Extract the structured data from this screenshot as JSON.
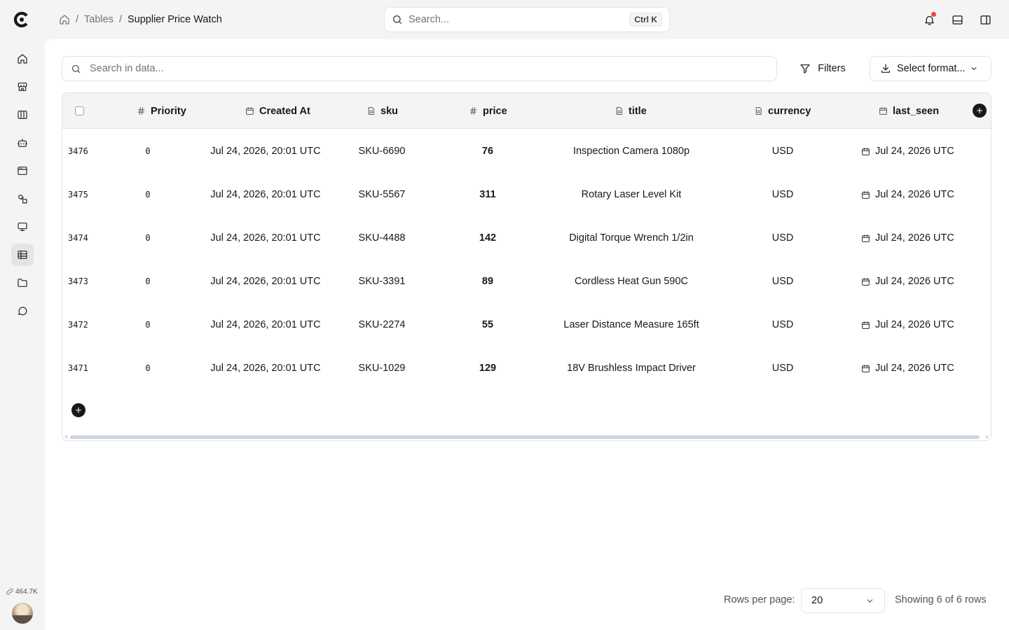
{
  "breadcrumb": {
    "separator": "/",
    "tables": "Tables",
    "current": "Supplier Price Watch"
  },
  "top_search": {
    "placeholder": "Search...",
    "shortcut": "Ctrl K"
  },
  "sidebar": {
    "items": [
      {
        "name": "home",
        "icon": "home-icon"
      },
      {
        "name": "store",
        "icon": "store-icon"
      },
      {
        "name": "columns",
        "icon": "columns-icon"
      },
      {
        "name": "bot",
        "icon": "bot-icon"
      },
      {
        "name": "browser",
        "icon": "browser-icon"
      },
      {
        "name": "shapes",
        "icon": "shapes-icon"
      },
      {
        "name": "monitor",
        "icon": "monitor-icon"
      },
      {
        "name": "tables",
        "icon": "table-icon",
        "active": true
      },
      {
        "name": "folder",
        "icon": "folder-icon"
      },
      {
        "name": "chat",
        "icon": "message-icon"
      }
    ],
    "usage": "464.7K"
  },
  "toolbar": {
    "search_placeholder": "Search in data...",
    "filters_label": "Filters",
    "format_label": "Select format..."
  },
  "table": {
    "columns": [
      {
        "key": "priority",
        "label": "Priority",
        "icon": "hash-icon"
      },
      {
        "key": "created_at",
        "label": "Created At",
        "icon": "calendar-icon"
      },
      {
        "key": "sku",
        "label": "sku",
        "icon": "text-icon"
      },
      {
        "key": "price",
        "label": "price",
        "icon": "hash-icon"
      },
      {
        "key": "title",
        "label": "title",
        "icon": "text-icon"
      },
      {
        "key": "currency",
        "label": "currency",
        "icon": "text-icon"
      },
      {
        "key": "last_seen",
        "label": "last_seen",
        "icon": "calendar-icon"
      }
    ],
    "rows": [
      {
        "id": "3476",
        "priority": "0",
        "created_at": "Jul 24, 2026, 20:01 UTC",
        "sku": "SKU-6690",
        "price": "76",
        "title": "Inspection Camera 1080p",
        "currency": "USD",
        "last_seen": "Jul 24, 2026 UTC"
      },
      {
        "id": "3475",
        "priority": "0",
        "created_at": "Jul 24, 2026, 20:01 UTC",
        "sku": "SKU-5567",
        "price": "311",
        "title": "Rotary Laser Level Kit",
        "currency": "USD",
        "last_seen": "Jul 24, 2026 UTC"
      },
      {
        "id": "3474",
        "priority": "0",
        "created_at": "Jul 24, 2026, 20:01 UTC",
        "sku": "SKU-4488",
        "price": "142",
        "title": "Digital Torque Wrench 1/2in",
        "currency": "USD",
        "last_seen": "Jul 24, 2026 UTC"
      },
      {
        "id": "3473",
        "priority": "0",
        "created_at": "Jul 24, 2026, 20:01 UTC",
        "sku": "SKU-3391",
        "price": "89",
        "title": "Cordless Heat Gun 590C",
        "currency": "USD",
        "last_seen": "Jul 24, 2026 UTC"
      },
      {
        "id": "3472",
        "priority": "0",
        "created_at": "Jul 24, 2026, 20:01 UTC",
        "sku": "SKU-2274",
        "price": "55",
        "title": "Laser Distance Measure 165ft",
        "currency": "USD",
        "last_seen": "Jul 24, 2026 UTC"
      },
      {
        "id": "3471",
        "priority": "0",
        "created_at": "Jul 24, 2026, 20:01 UTC",
        "sku": "SKU-1029",
        "price": "129",
        "title": "18V Brushless Impact Driver",
        "currency": "USD",
        "last_seen": "Jul 24, 2026 UTC"
      }
    ]
  },
  "pagination": {
    "rows_per_page_label": "Rows per page:",
    "rows_per_page_value": "20",
    "info": "Showing 6 of 6 rows"
  }
}
